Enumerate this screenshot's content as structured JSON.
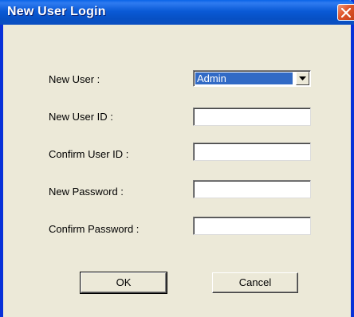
{
  "window": {
    "title": "New User Login"
  },
  "form": {
    "new_user_label": "New User :",
    "new_user_value": "Admin",
    "new_user_id_label": "New User ID :",
    "new_user_id_value": "",
    "confirm_user_id_label": "Confirm User ID :",
    "confirm_user_id_value": "",
    "new_password_label": "New Password :",
    "new_password_value": "",
    "confirm_password_label": "Confirm Password :",
    "confirm_password_value": ""
  },
  "buttons": {
    "ok_label": "OK",
    "cancel_label": "Cancel"
  },
  "icons": {
    "close": "close-icon",
    "dropdown": "chevron-down-icon"
  },
  "colors": {
    "titlebar": "#0a5ad6",
    "close_button": "#e0542a",
    "selection": "#316ac5",
    "dialog_background": "#ece9d8"
  }
}
